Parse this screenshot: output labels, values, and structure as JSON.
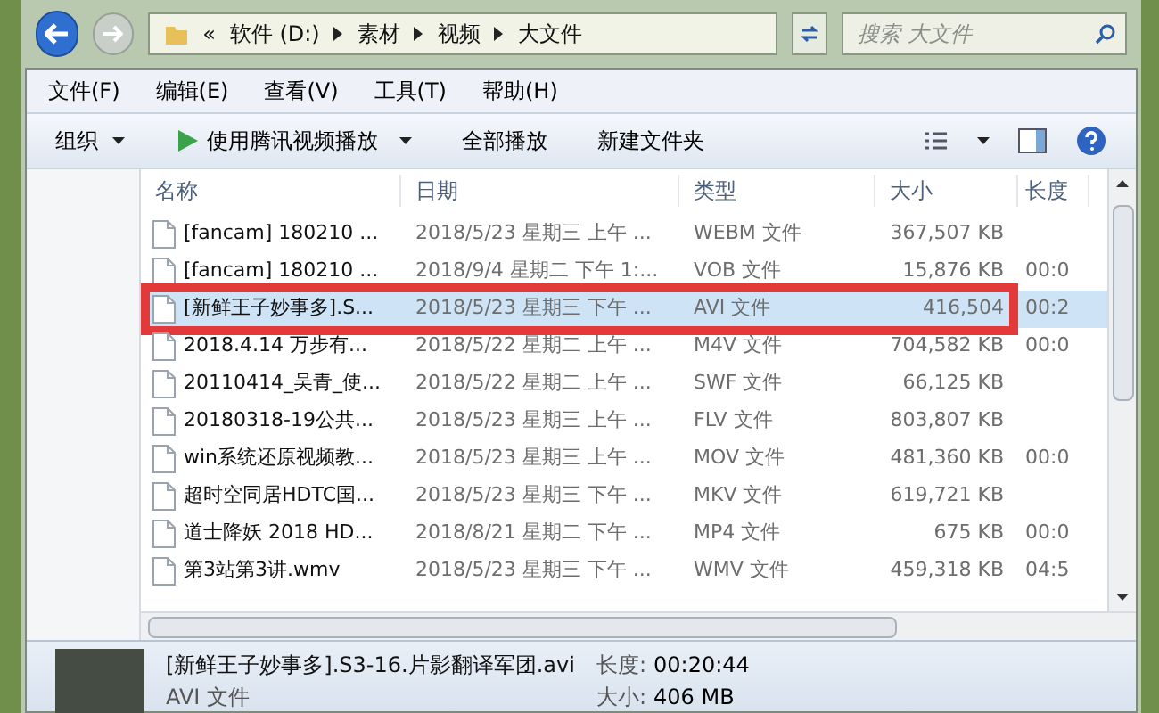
{
  "address": {
    "parts": [
      "«",
      "软件 (D:)",
      "素材",
      "视频",
      "大文件"
    ]
  },
  "search": {
    "placeholder": "搜索 大文件"
  },
  "menu": [
    "文件(F)",
    "编辑(E)",
    "查看(V)",
    "工具(T)",
    "帮助(H)"
  ],
  "toolbar": [
    {
      "kind": "dropdown",
      "label": "组织"
    },
    {
      "kind": "play",
      "label": "使用腾讯视频播放"
    },
    {
      "kind": "plain",
      "label": "全部播放"
    },
    {
      "kind": "plain",
      "label": "新建文件夹"
    }
  ],
  "columns": [
    "名称",
    "日期",
    "类型",
    "大小",
    "长度"
  ],
  "rows": [
    {
      "name": "[fancam] 180210 ...",
      "date": "2018/5/23 星期三 上午 ...",
      "type": "WEBM 文件",
      "size": "367,507 KB",
      "length": "",
      "selected": false,
      "highlighted": false
    },
    {
      "name": "[fancam] 180210 ...",
      "date": "2018/9/4 星期二 下午 1:...",
      "type": "VOB 文件",
      "size": "15,876 KB",
      "length": "00:0",
      "selected": false,
      "highlighted": false
    },
    {
      "name": "[新鲜王子妙事多].S...",
      "date": "2018/5/23 星期三 下午 ...",
      "type": "AVI 文件",
      "size": "416,504",
      "length": "00:2",
      "selected": true,
      "highlighted": true
    },
    {
      "name": "2018.4.14 万步有...",
      "date": "2018/5/22 星期二 上午 ...",
      "type": "M4V 文件",
      "size": "704,582 KB",
      "length": "00:0",
      "selected": false,
      "highlighted": false
    },
    {
      "name": "20110414_吴青_使...",
      "date": "2018/5/22 星期二 上午 ...",
      "type": "SWF 文件",
      "size": "66,125 KB",
      "length": "",
      "selected": false,
      "highlighted": false
    },
    {
      "name": "20180318-19公共...",
      "date": "2018/5/23 星期三 上午 ...",
      "type": "FLV 文件",
      "size": "803,807 KB",
      "length": "",
      "selected": false,
      "highlighted": false
    },
    {
      "name": "win系统还原视频教...",
      "date": "2018/5/23 星期三 上午 ...",
      "type": "MOV 文件",
      "size": "481,360 KB",
      "length": "00:0",
      "selected": false,
      "highlighted": false
    },
    {
      "name": "超时空同居HDTC国...",
      "date": "2018/5/23 星期三 下午 ...",
      "type": "MKV 文件",
      "size": "619,721 KB",
      "length": "",
      "selected": false,
      "highlighted": false
    },
    {
      "name": "道士降妖 2018 HD...",
      "date": "2018/8/21 星期二 下午 ...",
      "type": "MP4 文件",
      "size": "675 KB",
      "length": "00:0",
      "selected": false,
      "highlighted": false
    },
    {
      "name": "第3站第3讲.wmv",
      "date": "2018/5/23 星期三 下午 ...",
      "type": "WMV 文件",
      "size": "459,318 KB",
      "length": "04:5",
      "selected": false,
      "highlighted": false
    }
  ],
  "details": {
    "name": "[新鲜王子妙事多].S3-16.片影翻译军团.avi",
    "type": "AVI 文件",
    "length_label": "长度:",
    "length": "00:20:44",
    "size_label": "大小:",
    "size": "406 MB"
  }
}
